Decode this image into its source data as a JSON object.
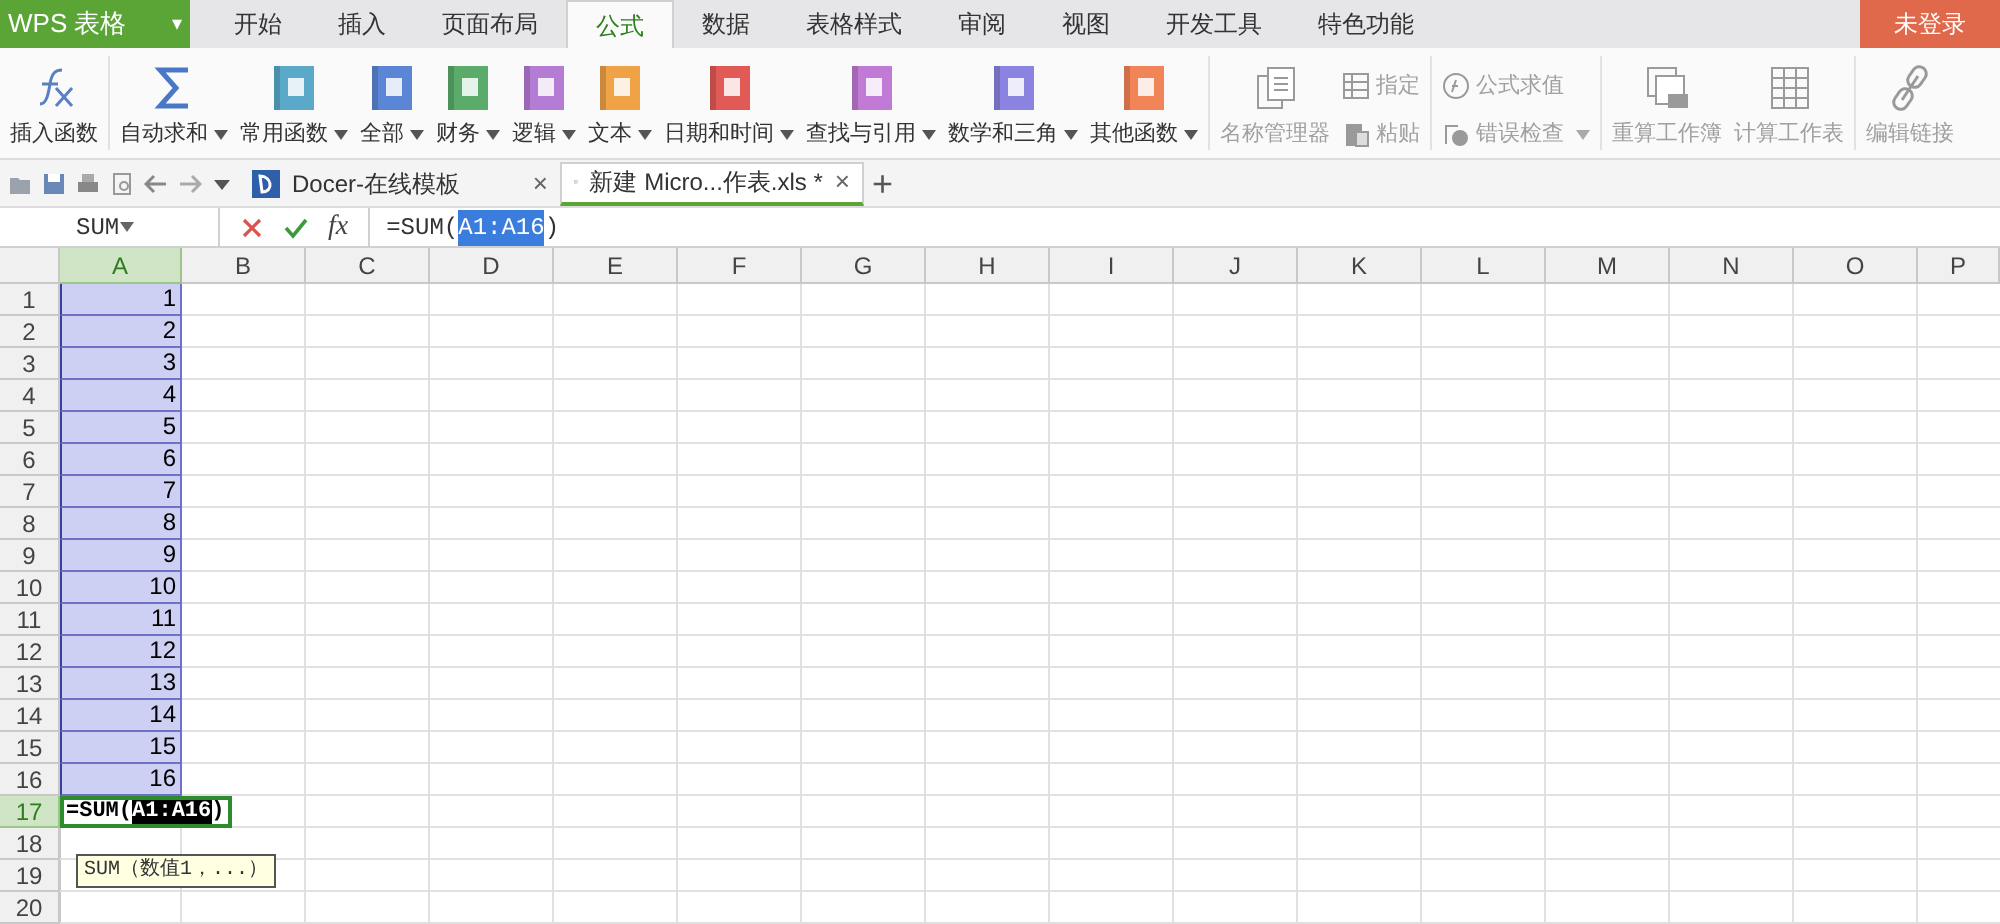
{
  "app_button": {
    "label": "WPS 表格",
    "caret": "▾"
  },
  "menu_tabs": [
    {
      "label": "开始",
      "selected": false
    },
    {
      "label": "插入",
      "selected": false
    },
    {
      "label": "页面布局",
      "selected": false
    },
    {
      "label": "公式",
      "selected": true
    },
    {
      "label": "数据",
      "selected": false
    },
    {
      "label": "表格样式",
      "selected": false
    },
    {
      "label": "审阅",
      "selected": false
    },
    {
      "label": "视图",
      "selected": false
    },
    {
      "label": "开发工具",
      "selected": false
    },
    {
      "label": "特色功能",
      "selected": false
    }
  ],
  "login_button": "未登录",
  "ribbon_groups": [
    {
      "items": [
        {
          "kind": "fx",
          "label": "插入函数",
          "dropdown": false,
          "disabled": false
        }
      ]
    },
    {
      "items": [
        {
          "kind": "sigma",
          "label": "自动求和",
          "dropdown": true,
          "disabled": false
        },
        {
          "kind": "book",
          "label": "常用函数",
          "dropdown": true,
          "disabled": false,
          "color": "#5aa9c9"
        },
        {
          "kind": "book",
          "label": "全部",
          "dropdown": true,
          "disabled": false,
          "color": "#5b86d6"
        },
        {
          "kind": "book",
          "label": "财务",
          "dropdown": true,
          "disabled": false,
          "color": "#5bab6a"
        },
        {
          "kind": "book",
          "label": "逻辑",
          "dropdown": true,
          "disabled": false,
          "color": "#b57cd6"
        },
        {
          "kind": "book",
          "label": "文本",
          "dropdown": true,
          "disabled": false,
          "color": "#f0a247"
        },
        {
          "kind": "book",
          "label": "日期和时间",
          "dropdown": true,
          "disabled": false,
          "color": "#e25a55"
        },
        {
          "kind": "book",
          "label": "查找与引用",
          "dropdown": true,
          "disabled": false,
          "color": "#c17ad6"
        },
        {
          "kind": "book",
          "label": "数学和三角",
          "dropdown": true,
          "disabled": false,
          "color": "#8a84e0"
        },
        {
          "kind": "book",
          "label": "其他函数",
          "dropdown": true,
          "disabled": false,
          "color": "#f28557"
        }
      ]
    },
    {
      "items": [
        {
          "kind": "names",
          "label": "名称管理器",
          "dropdown": false,
          "disabled": true
        },
        {
          "kind": "assign",
          "label": "指定",
          "dropdown": false,
          "disabled": true
        },
        {
          "kind": "paste",
          "label": "粘贴",
          "dropdown": false,
          "disabled": true
        }
      ]
    },
    {
      "items": [
        {
          "kind": "evaluate",
          "label": "公式求值",
          "dropdown": false,
          "disabled": true
        },
        {
          "kind": "errorcheck",
          "label": "错误检查",
          "dropdown": true,
          "disabled": true
        }
      ]
    },
    {
      "items": [
        {
          "kind": "workbook",
          "label": "重算工作簿",
          "dropdown": false,
          "disabled": true
        },
        {
          "kind": "sheet",
          "label": "计算工作表",
          "dropdown": false,
          "disabled": true
        }
      ]
    },
    {
      "items": [
        {
          "kind": "link",
          "label": "编辑链接",
          "dropdown": false,
          "disabled": true
        }
      ]
    }
  ],
  "doc_tabs": [
    {
      "label": "Docer-在线模板",
      "selected": false,
      "close": "×"
    },
    {
      "label": "新建 Micro...作表.xls *",
      "selected": true,
      "close": "×"
    }
  ],
  "new_tab": "+",
  "formula_bar": {
    "name_box": "SUM",
    "fx": "fx",
    "formula_prefix": "=SUM(",
    "formula_ref": "A1:A16",
    "formula_suffix": ")"
  },
  "grid": {
    "columns": [
      {
        "label": "A",
        "selected": true
      },
      {
        "label": "B",
        "selected": false
      },
      {
        "label": "C",
        "selected": false
      },
      {
        "label": "D",
        "selected": false
      },
      {
        "label": "E",
        "selected": false
      },
      {
        "label": "F",
        "selected": false
      },
      {
        "label": "G",
        "selected": false
      },
      {
        "label": "H",
        "selected": false
      },
      {
        "label": "I",
        "selected": false
      },
      {
        "label": "J",
        "selected": false
      },
      {
        "label": "K",
        "selected": false
      },
      {
        "label": "L",
        "selected": false
      },
      {
        "label": "M",
        "selected": false
      },
      {
        "label": "N",
        "selected": false
      },
      {
        "label": "O",
        "selected": false
      },
      {
        "label": "P",
        "selected": false
      }
    ],
    "rows": [
      {
        "label": "1",
        "selected": false,
        "cells": [
          {
            "kind": "number",
            "value": "1",
            "in_range": true
          }
        ]
      },
      {
        "label": "2",
        "selected": false,
        "cells": [
          {
            "kind": "number",
            "value": "2",
            "in_range": true
          }
        ]
      },
      {
        "label": "3",
        "selected": false,
        "cells": [
          {
            "kind": "number",
            "value": "3",
            "in_range": true
          }
        ]
      },
      {
        "label": "4",
        "selected": false,
        "cells": [
          {
            "kind": "number",
            "value": "4",
            "in_range": true
          }
        ]
      },
      {
        "label": "5",
        "selected": false,
        "cells": [
          {
            "kind": "number",
            "value": "5",
            "in_range": true
          }
        ]
      },
      {
        "label": "6",
        "selected": false,
        "cells": [
          {
            "kind": "number",
            "value": "6",
            "in_range": true
          }
        ]
      },
      {
        "label": "7",
        "selected": false,
        "cells": [
          {
            "kind": "number",
            "value": "7",
            "in_range": true
          }
        ]
      },
      {
        "label": "8",
        "selected": false,
        "cells": [
          {
            "kind": "number",
            "value": "8",
            "in_range": true
          }
        ]
      },
      {
        "label": "9",
        "selected": false,
        "cells": [
          {
            "kind": "number",
            "value": "9",
            "in_range": true
          }
        ]
      },
      {
        "label": "10",
        "selected": false,
        "cells": [
          {
            "kind": "number",
            "value": "10",
            "in_range": true
          }
        ]
      },
      {
        "label": "11",
        "selected": false,
        "cells": [
          {
            "kind": "number",
            "value": "11",
            "in_range": true
          }
        ]
      },
      {
        "label": "12",
        "selected": false,
        "cells": [
          {
            "kind": "number",
            "value": "12",
            "in_range": true
          }
        ]
      },
      {
        "label": "13",
        "selected": false,
        "cells": [
          {
            "kind": "number",
            "value": "13",
            "in_range": true
          }
        ]
      },
      {
        "label": "14",
        "selected": false,
        "cells": [
          {
            "kind": "number",
            "value": "14",
            "in_range": true
          }
        ]
      },
      {
        "label": "15",
        "selected": false,
        "cells": [
          {
            "kind": "number",
            "value": "15",
            "in_range": true
          }
        ]
      },
      {
        "label": "16",
        "selected": false,
        "cells": [
          {
            "kind": "number",
            "value": "16",
            "in_range": true
          }
        ]
      },
      {
        "label": "17",
        "selected": true,
        "cells": [
          {
            "kind": "formula",
            "prefix": "=SUM(",
            "ref": "A1:A16",
            "suffix": ")",
            "in_range": false
          }
        ]
      },
      {
        "label": "18",
        "selected": false
      },
      {
        "label": "19",
        "selected": false
      },
      {
        "label": "20",
        "selected": false
      }
    ]
  },
  "tooltip": "SUM（数值1，...）"
}
